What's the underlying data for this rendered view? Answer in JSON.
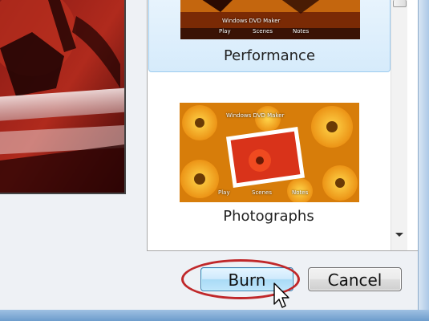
{
  "dialog": {
    "styles": [
      {
        "label": "Performance",
        "selected": true,
        "thumb_title": "Windows DVD Maker",
        "menu": [
          "Play",
          "Scenes",
          "Notes"
        ]
      },
      {
        "label": "Photographs",
        "selected": false,
        "thumb_title": "Windows DVD Maker",
        "menu": [
          "Play",
          "Scenes",
          "Notes"
        ]
      }
    ],
    "buttons": {
      "burn": "Burn",
      "cancel": "Cancel"
    }
  },
  "colors": {
    "highlight_ring": "#c0282a",
    "selected_item_bg": "#d6ebfb",
    "preview_red": "#5a0d0b"
  },
  "icons": {
    "cursor": "pointer-cursor-icon",
    "scroll_down": "scroll-down-arrow-icon"
  }
}
